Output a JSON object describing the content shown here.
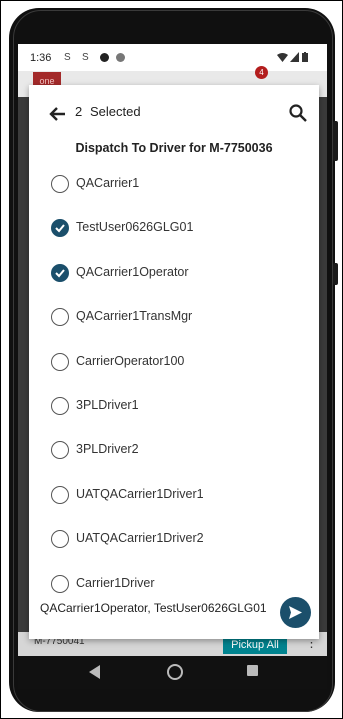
{
  "status_bar": {
    "time": "1:36",
    "sim_icons": [
      "S",
      "S"
    ]
  },
  "app_header": {
    "logo_text": "one",
    "notification_count": "4"
  },
  "dialog": {
    "selected_count": "2",
    "selected_label": "Selected",
    "title": "Dispatch To Driver  for M-7750036",
    "items": [
      {
        "label": "QACarrier1",
        "checked": false
      },
      {
        "label": "TestUser0626GLG01",
        "checked": true
      },
      {
        "label": "QACarrier1Operator",
        "checked": true
      },
      {
        "label": "QACarrier1TransMgr",
        "checked": false
      },
      {
        "label": "CarrierOperator100",
        "checked": false
      },
      {
        "label": "3PLDriver1",
        "checked": false
      },
      {
        "label": "3PLDriver2",
        "checked": false
      },
      {
        "label": "UATQACarrier1Driver1",
        "checked": false
      },
      {
        "label": "UATQACarrier1Driver2",
        "checked": false
      },
      {
        "label": "Carrier1Driver",
        "checked": false
      }
    ],
    "selected_summary": "QACarrier1Operator, TestUser0626GLG01"
  },
  "background": {
    "row_label": "M-7750041",
    "pickup_all_label": "Pickup All"
  },
  "colors": {
    "accent": "#1b4f6b",
    "teal_button": "#00838f",
    "badge": "#b31d1d"
  }
}
